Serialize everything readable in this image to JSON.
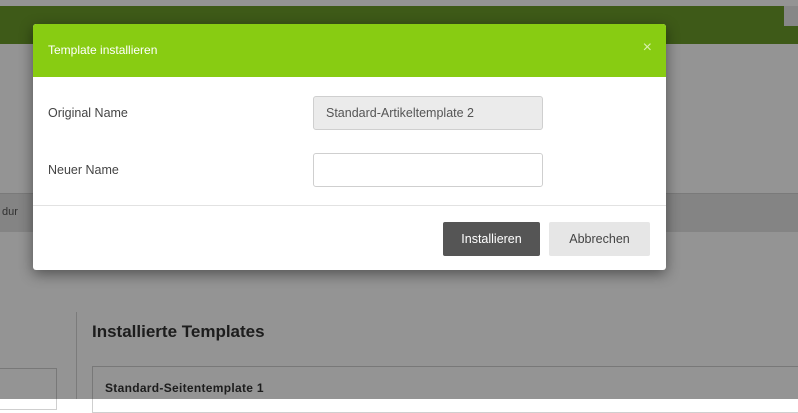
{
  "background": {
    "left_strip_text": "dur",
    "section_heading": "Installierte Templates",
    "template_item": "Standard-Seitentemplate 1"
  },
  "modal": {
    "title": "Template installieren",
    "close_icon": "×",
    "original_name_label": "Original Name",
    "original_name_value": "Standard-Artikeltemplate 2",
    "new_name_label": "Neuer Name",
    "new_name_value": "",
    "install_label": "Installieren",
    "cancel_label": "Abbrechen"
  },
  "colors": {
    "header_green": "#88cc12",
    "topbar_green": "#6b9c2a",
    "install_button": "#555555"
  }
}
